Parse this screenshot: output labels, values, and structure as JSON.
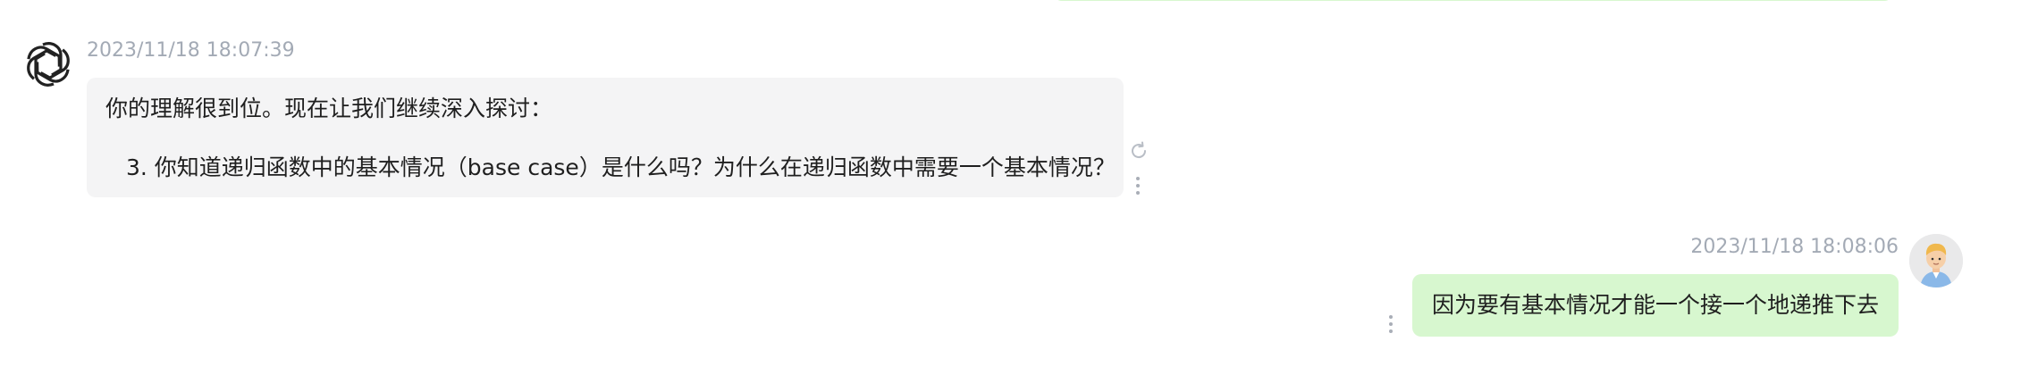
{
  "conversation": {
    "assistant_message": {
      "timestamp": "2023/11/18 18:07:39",
      "line1": "你的理解很到位。现在让我们继续深入探讨：",
      "line2": "3. 你知道递归函数中的基本情况（base case）是什么吗？为什么在递归函数中需要一个基本情况？",
      "avatar_icon": "openai-logo-icon"
    },
    "user_message": {
      "timestamp": "2023/11/18 18:08:06",
      "text": "因为要有基本情况才能一个接一个地递推下去",
      "avatar_icon": "user-avatar-icon"
    }
  },
  "colors": {
    "assistant_bubble": "#f4f4f5",
    "user_bubble": "#d7f7cf",
    "timestamp": "#a3aab5",
    "text": "#1f1f1f"
  }
}
